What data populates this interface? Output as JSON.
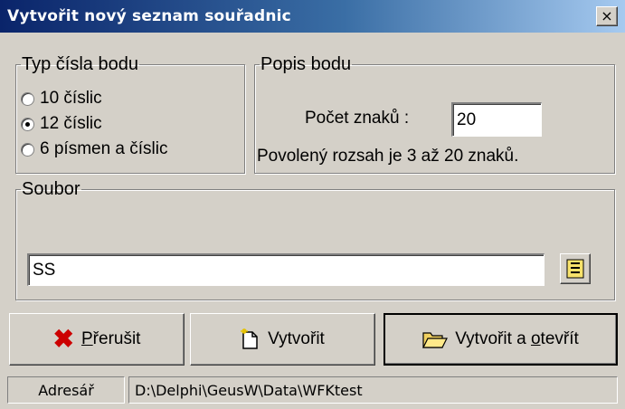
{
  "window": {
    "title": "Vytvořit nový seznam souřadnic",
    "close_label": "×"
  },
  "typ_group": {
    "legend": "Typ čísla bodu",
    "options": [
      {
        "label": "10 číslic",
        "selected": false
      },
      {
        "label": "12 číslic",
        "selected": true
      },
      {
        "label": "6 písmen a číslic",
        "selected": false
      }
    ]
  },
  "popis_group": {
    "legend": "Popis bodu",
    "count_label": "Počet znaků :",
    "count_value": "20",
    "range_text": "Povolený rozsah je 3 až 20 znaků."
  },
  "soubor_group": {
    "legend": "Soubor",
    "file_value": "SS"
  },
  "buttons": {
    "cancel": {
      "prefix": "",
      "underline": "P",
      "rest": "řerušit"
    },
    "create": {
      "label": "Vytvořit"
    },
    "create_open": {
      "prefix": "Vytvořit a ",
      "underline": "o",
      "rest": "tevřít"
    }
  },
  "statusbar": {
    "label": "Adresář",
    "path": "D:\\Delphi\\GeusW\\Data\\WFKtest"
  },
  "colors": {
    "title_start": "#0a246a",
    "title_end": "#a6caf0",
    "cancel_icon": "#cc0000"
  },
  "icons": {
    "cancel": "x-mark-icon",
    "create": "new-document-icon",
    "create_open": "open-folder-icon",
    "browse": "file-browse-icon"
  }
}
